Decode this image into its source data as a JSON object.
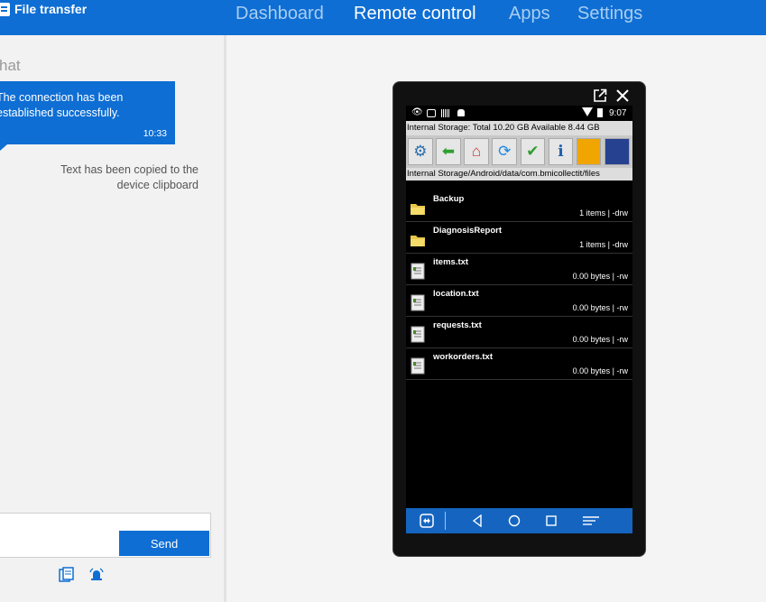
{
  "header": {
    "file_transfer_label": "File transfer",
    "tabs": [
      "Dashboard",
      "Remote control",
      "Apps",
      "Settings"
    ],
    "active_tab": "Remote control"
  },
  "chat": {
    "title": "hat",
    "bubble": {
      "line1": "The connection has been",
      "line2": "established successfully.",
      "time": "10:33"
    },
    "system_message": {
      "line1": "Text has been copied to the",
      "line2": "device clipboard"
    },
    "input_value": "",
    "send_label": "Send"
  },
  "device": {
    "status_time": "9:07",
    "storage_info": "Internal Storage:  Total 10.20 GB  Available 8.44 GB",
    "path": "Internal Storage/Android/data/com.bmicollectit/files",
    "files": [
      {
        "name": "Backup",
        "meta": "1 items | -drw",
        "type": "folder"
      },
      {
        "name": "DiagnosisReport",
        "meta": "1 items | -drw",
        "type": "folder"
      },
      {
        "name": "items.txt",
        "meta": "0.00 bytes  | -rw",
        "type": "file"
      },
      {
        "name": "location.txt",
        "meta": "0.00 bytes  | -rw",
        "type": "file"
      },
      {
        "name": "requests.txt",
        "meta": "0.00 bytes  | -rw",
        "type": "file"
      },
      {
        "name": "workorders.txt",
        "meta": "0.00 bytes  | -rw",
        "type": "file"
      }
    ]
  },
  "colors": {
    "brand_blue": "#0e6ed3",
    "nav_inactive": "#a9cdf2",
    "android_nav": "#1565c0"
  },
  "icons": {
    "toolbar": [
      "gear-icon",
      "back-arrow-icon",
      "home-icon",
      "refresh-icon",
      "check-icon",
      "info-icon",
      "folder-icon",
      "sdcard-icon"
    ]
  }
}
